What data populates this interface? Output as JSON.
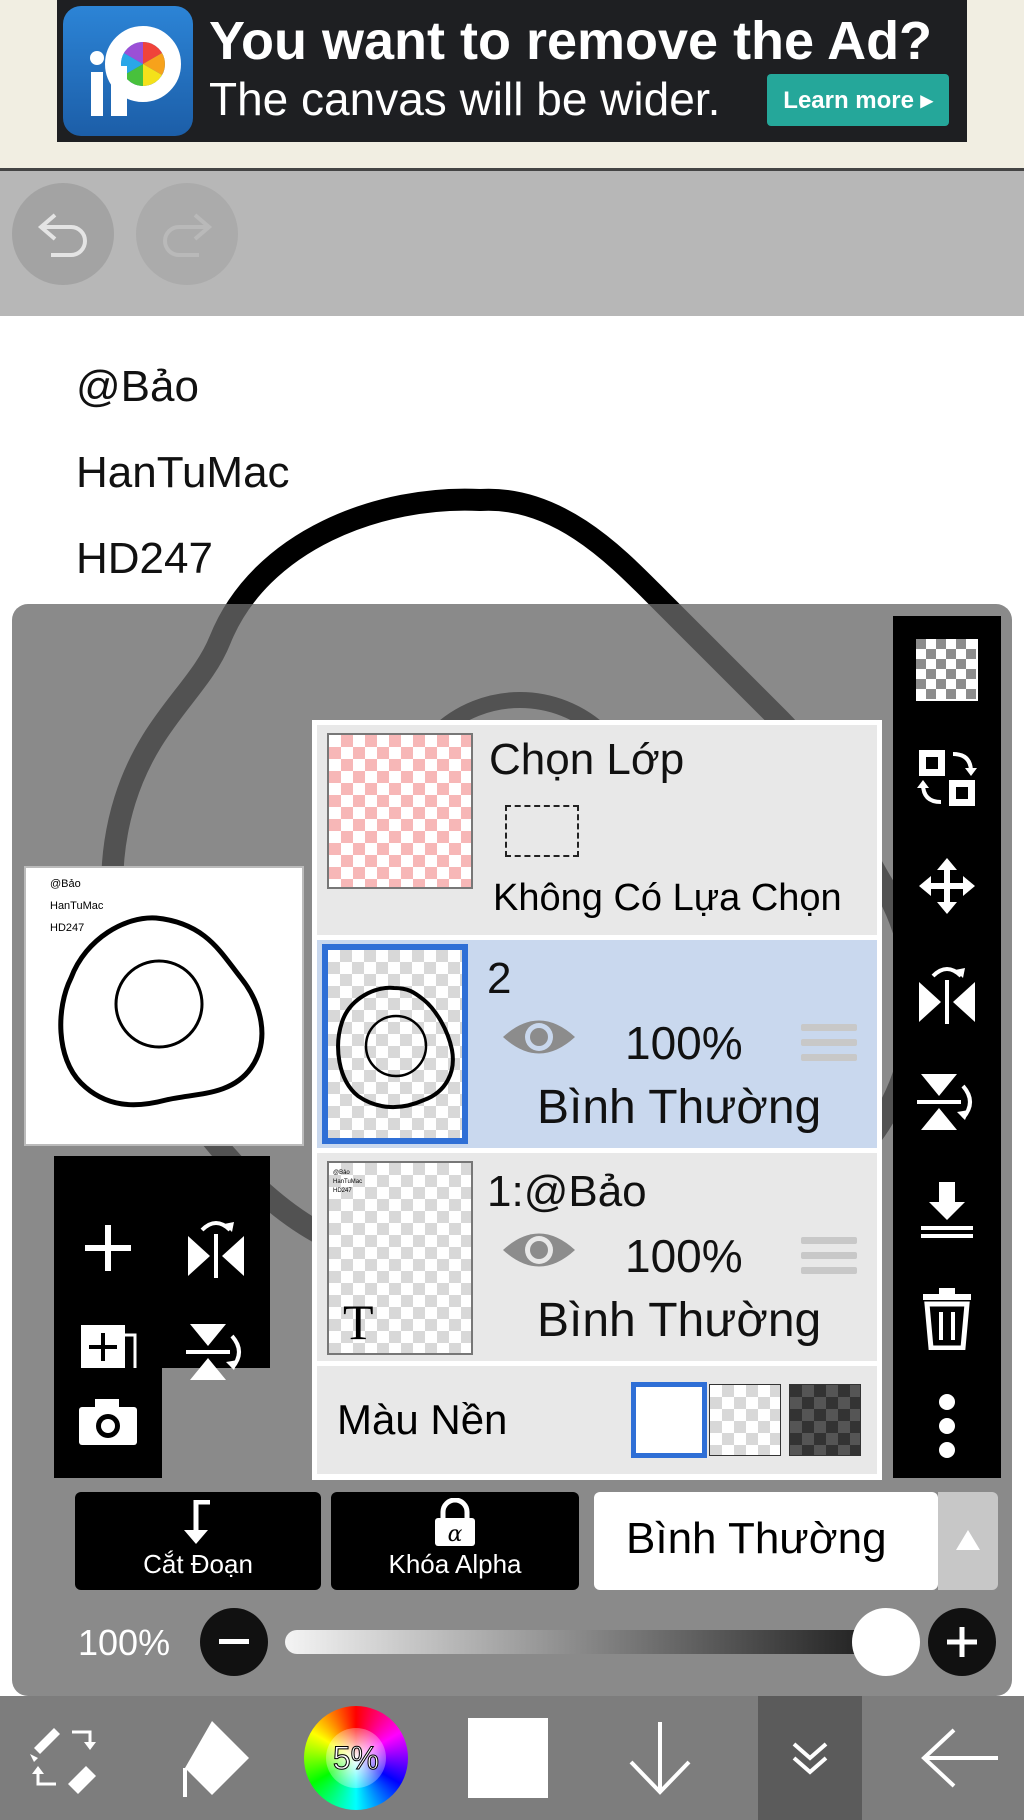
{
  "ad": {
    "headline": "You want to remove the Ad?",
    "subtext": "The canvas will be wider.",
    "cta": "Learn more ▸",
    "logo_text": "iP"
  },
  "toolbar": {
    "undo_icon": "undo-icon",
    "redo_icon": "redo-icon"
  },
  "canvas_text": [
    "@Bảo",
    "HanTuMac",
    "HD247"
  ],
  "preview": {
    "lines": [
      "@Bảo",
      "HanTuMac",
      "HD247"
    ]
  },
  "layers": {
    "selection": {
      "title": "Chọn Lớp",
      "status": "Không Có Lựa Chọn"
    },
    "items": [
      {
        "name": "2",
        "opacity": "100%",
        "blend": "Bình Thường",
        "selected": true
      },
      {
        "name": "1:@Bảo",
        "opacity": "100%",
        "blend": "Bình Thường",
        "selected": false,
        "thumb_glyph": "T"
      }
    ],
    "background": {
      "label": "Màu Nền",
      "options": [
        "white",
        "transparent",
        "dark"
      ],
      "selected": "white"
    }
  },
  "actions": {
    "clipping_label": "Cắt Đoạn",
    "alpha_lock_label": "Khóa Alpha",
    "blend_mode": "Bình Thường"
  },
  "opacity": {
    "label": "100%",
    "value": 1.0
  },
  "bottom_bar": {
    "color_percent": "5%"
  },
  "colors": {
    "accent": "#2f6fd6",
    "selected_row": "#c9d8ee",
    "ad_button": "#25a79a"
  }
}
